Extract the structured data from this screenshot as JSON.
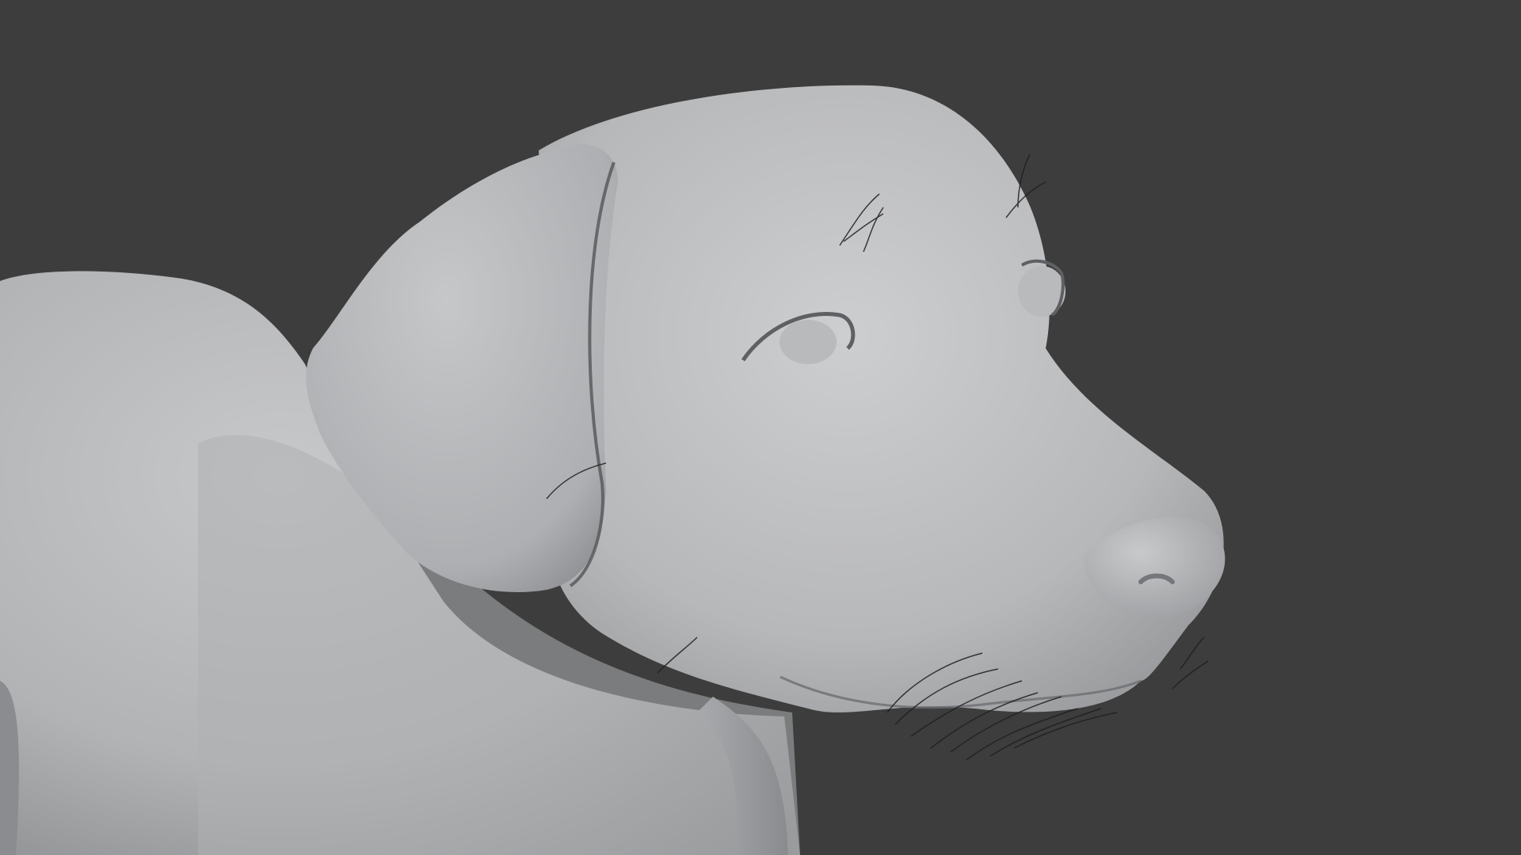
{
  "viewport": {
    "background_color": "#3d3d3d",
    "model_base_color": "#b4b5b7",
    "model_shadow_color": "#6e6f72",
    "hair_color": "#1f1f1f"
  }
}
